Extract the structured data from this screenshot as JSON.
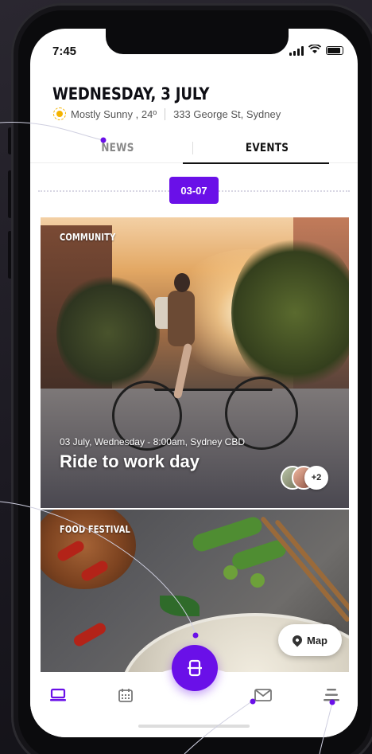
{
  "status_bar": {
    "time": "7:45"
  },
  "header": {
    "date": "WEDNESDAY, 3 JULY",
    "weather": "Mostly Sunny , 24º",
    "location": "333 George St, Sydney"
  },
  "tabs": [
    {
      "label": "NEWS",
      "active": false
    },
    {
      "label": "EVENTS",
      "active": true
    }
  ],
  "timeline": {
    "selected_date": "03-07"
  },
  "cards": [
    {
      "category": "COMMUNITY",
      "meta": "03 July, Wednesday - 8:00am, Sydney CBD",
      "title": "Ride to work day",
      "extra_attendees": "+2"
    },
    {
      "category": "FOOD FESTIVAL"
    }
  ],
  "map_button": {
    "label": "Map"
  },
  "bottom_nav": {
    "items": [
      "home-icon",
      "calendar-icon",
      "mail-icon",
      "menu-icon"
    ],
    "fab_icon": "ticket-icon"
  },
  "colors": {
    "accent": "#6a10e8",
    "text_dark": "#111111",
    "muted": "#888888"
  }
}
